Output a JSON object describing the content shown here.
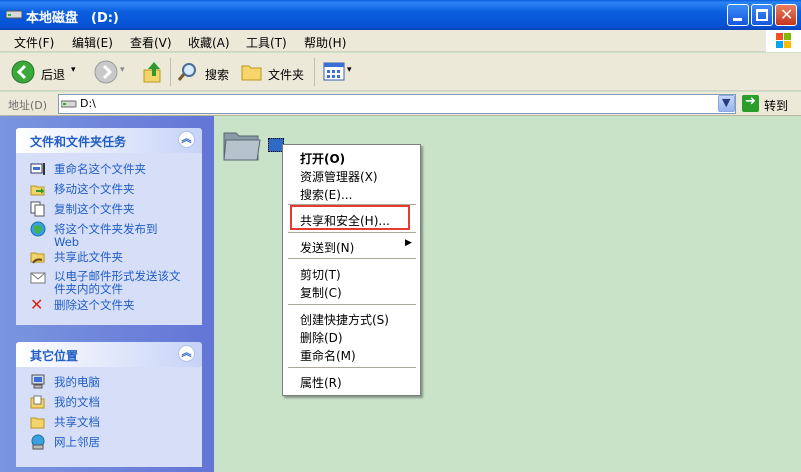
{
  "window": {
    "title": "本地磁盘　(D:)"
  },
  "menubar": {
    "items": [
      "文件(F)",
      "编辑(E)",
      "查看(V)",
      "收藏(A)",
      "工具(T)",
      "帮助(H)"
    ]
  },
  "toolbar": {
    "back": "后退",
    "search": "搜索",
    "folders": "文件夹"
  },
  "address": {
    "label": "地址(D)",
    "value": "D:\\",
    "go": "转到"
  },
  "left_pane": {
    "file_tasks": {
      "title": "文件和文件夹任务",
      "items": [
        "重命名这个文件夹",
        "移动这个文件夹",
        "复制这个文件夹",
        "将这个文件夹发布到 Web",
        "共享此文件夹",
        "以电子邮件形式发送该文件夹内的文件",
        "删除这个文件夹"
      ]
    },
    "other_places": {
      "title": "其它位置",
      "items": [
        "我的电脑",
        "我的文档",
        "共享文档",
        "网上邻居"
      ]
    }
  },
  "context_menu": {
    "items": [
      "打开(O)",
      "资源管理器(X)",
      "搜索(E)...",
      "共享和安全(H)...",
      "发送到(N)",
      "剪切(T)",
      "复制(C)",
      "创建快捷方式(S)",
      "删除(D)",
      "重命名(M)",
      "属性(R)"
    ]
  },
  "colors": {
    "titlebar": "#0a5ede",
    "task_link": "#215dc6",
    "highlight_box": "#e53b30",
    "content_bg": "#c9e3c9"
  }
}
